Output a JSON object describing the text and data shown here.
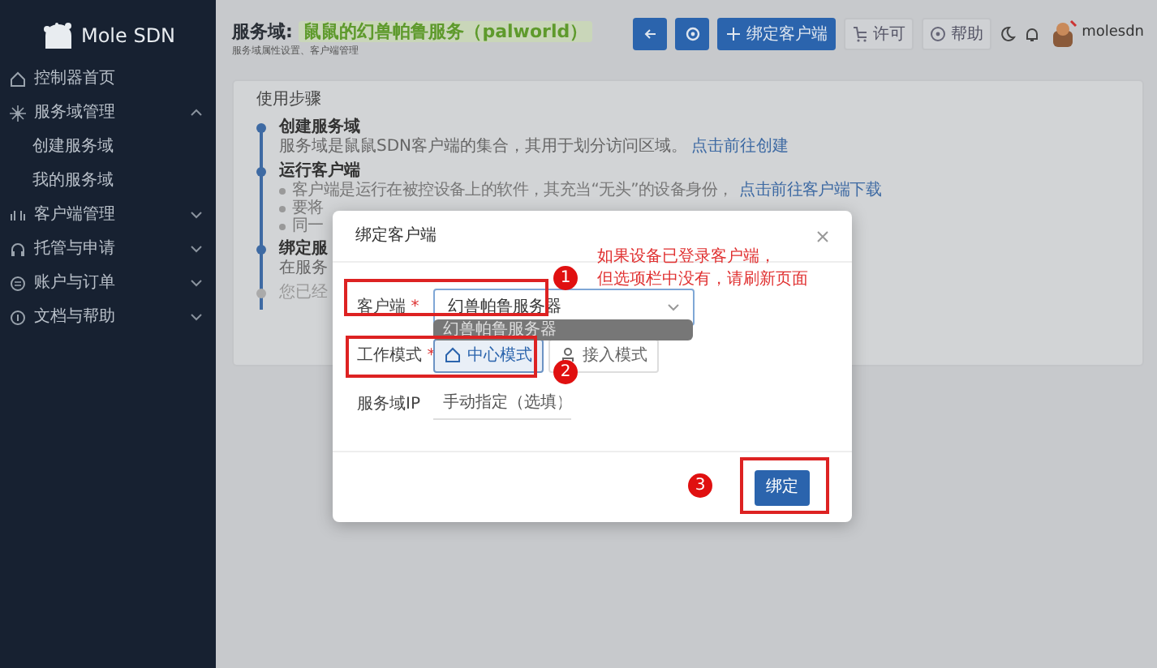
{
  "sidebar": {
    "logo": "Mole SDN",
    "items": [
      {
        "label": "控制器首页"
      },
      {
        "label": "服务域管理",
        "expanded": true,
        "children": [
          {
            "label": "创建服务域"
          },
          {
            "label": "我的服务域"
          }
        ]
      },
      {
        "label": "客户端管理",
        "expanded": false
      },
      {
        "label": "托管与申请",
        "expanded": false
      },
      {
        "label": "账户与订单",
        "expanded": false
      },
      {
        "label": "文档与帮助",
        "expanded": false
      }
    ]
  },
  "header": {
    "title_prefix": "服务域:",
    "title_name": "鼠鼠的幻兽帕鲁服务（palworld）",
    "subtitle": "服务域属性设置、客户端管理",
    "toolbar": [
      {
        "kind": "icon-primary"
      },
      {
        "kind": "icon-primary"
      },
      {
        "kind": "primary",
        "label": "绑定客户端"
      },
      {
        "kind": "outline",
        "label": "许可"
      },
      {
        "kind": "outline",
        "label": "帮助"
      }
    ],
    "user": "molesdn"
  },
  "steps_card": {
    "title": "使用步骤",
    "steps": [
      {
        "title": "创建服务域",
        "text": "服务域是鼠鼠SDN客户端的集合，其用于划分访问区域。",
        "link": "点击前往创建",
        "muted": false
      },
      {
        "title": "运行客户端",
        "bullets": [
          {
            "text": "客户端是运行在被控设备上的软件，其充当“无头”的设备身份，",
            "link": "点击前往客户端下载"
          },
          {
            "text": "要将"
          },
          {
            "text": "同一"
          }
        ],
        "muted": false
      },
      {
        "title": "绑定服",
        "text": "在服务",
        "muted": false
      },
      {
        "text": "您已经",
        "muted": true
      }
    ]
  },
  "modal": {
    "title": "绑定客户端",
    "fields": [
      {
        "kind": "select",
        "label": "客户端",
        "required_mark": "*",
        "value": "幻兽帕鲁服务器"
      },
      {
        "kind": "segmented",
        "label": "工作模式",
        "required_mark": "*",
        "options": [
          {
            "label": "中心模式",
            "selected": true
          },
          {
            "label": "接入模式",
            "selected": false
          }
        ]
      },
      {
        "kind": "input",
        "label": "服务域IP",
        "placeholder": "手动指定（选填）"
      }
    ],
    "dropdown_tooltip": "幻兽帕鲁服务器",
    "submit": "绑定"
  },
  "annotations": {
    "markers": [
      "1",
      "2",
      "3"
    ],
    "note": [
      "如果设备已登录客户端，",
      "但选项栏中没有，请刷新页面"
    ]
  }
}
